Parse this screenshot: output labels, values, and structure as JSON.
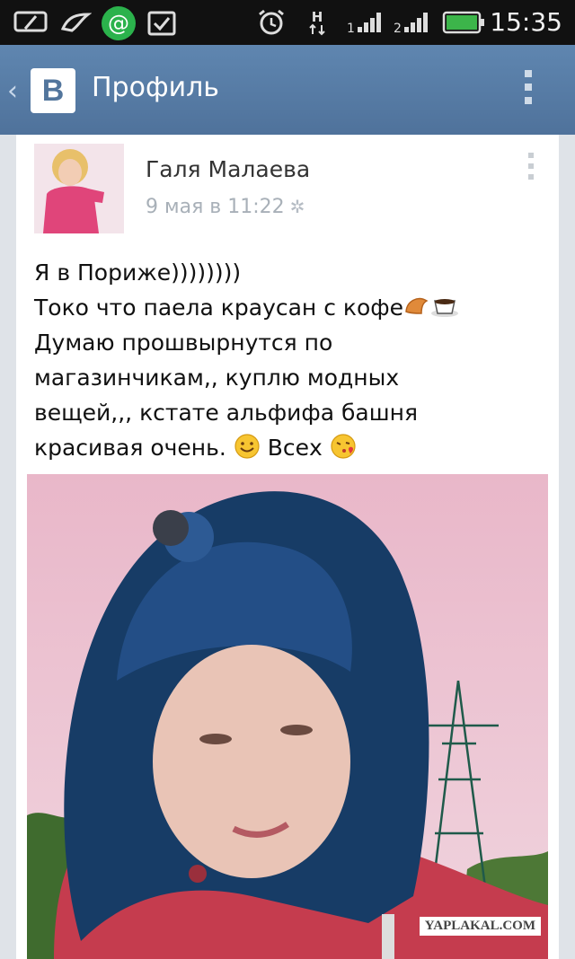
{
  "status_bar": {
    "time": "15:35",
    "icons": [
      "message-icon",
      "bird-icon",
      "at-sign-icon",
      "clipboard-check-icon",
      "alarm-icon",
      "network-h-icon",
      "signal-1-icon",
      "signal-2-icon",
      "battery-icon"
    ],
    "signal_labels": [
      "1",
      "2"
    ],
    "network_label": "H"
  },
  "header": {
    "title": "Профиль",
    "logo_text": "В",
    "color": "#5a7fa8"
  },
  "post": {
    "author": "Галя Малаева",
    "date": "9 мая в 11:22",
    "lines": [
      "Я в Пориже))))))))",
      "Токо что паела краусан с кофе",
      "Думаю прошвырнутся по",
      "магазинчикам,, куплю модных",
      "вещей,,, кстате альфифа башня",
      "красивая очень.",
      "Всех"
    ],
    "emojis": [
      "croissant-emoji",
      "coffee-emoji",
      "smile-emoji",
      "kiss-emoji"
    ]
  },
  "watermark": "YAPLAKAL.COM"
}
